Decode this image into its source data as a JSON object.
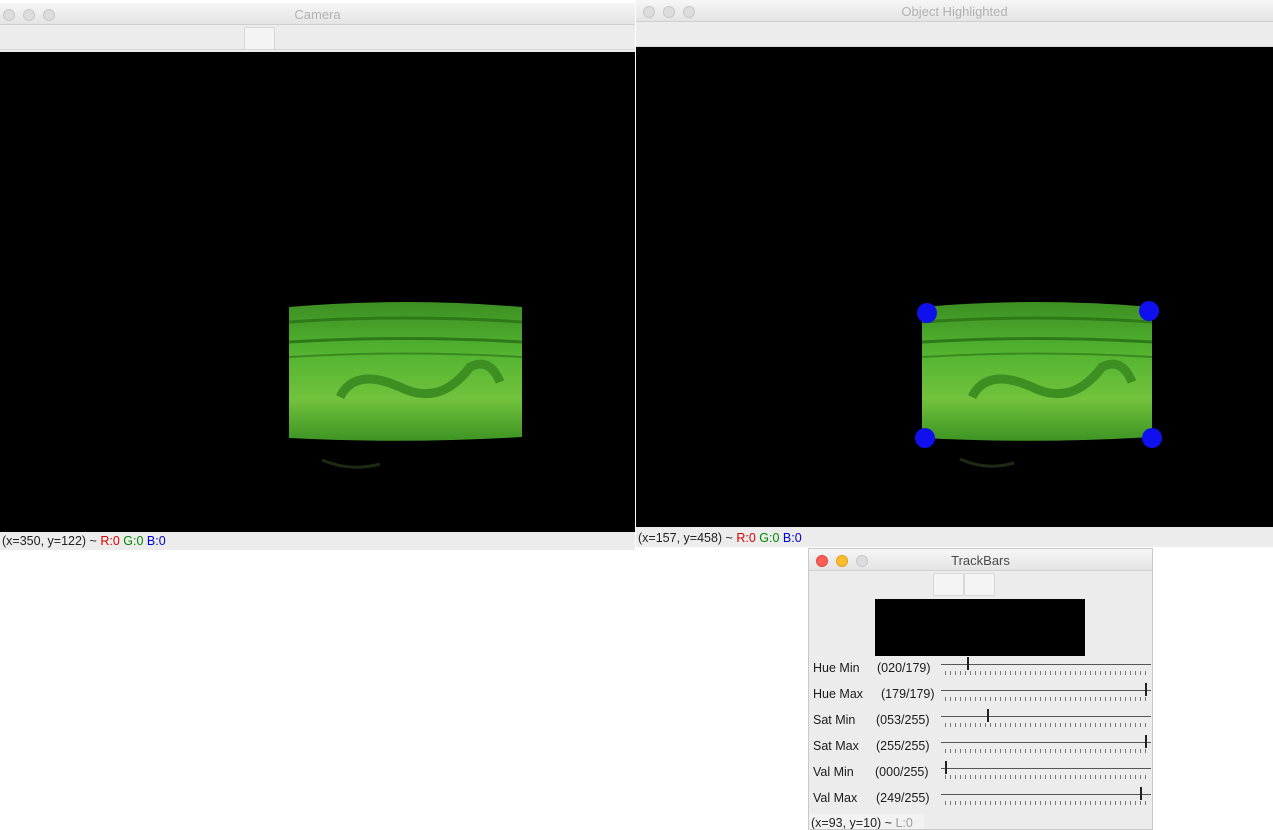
{
  "camera_window": {
    "title": "Camera",
    "status": {
      "coords": "(x=350, y=122) ~",
      "r": "R:0",
      "g": "G:0",
      "b": "B:0"
    }
  },
  "highlight_window": {
    "title": "Object Highlighted",
    "status": {
      "coords": "(x=157, y=458) ~",
      "r": "R:0",
      "g": "G:0",
      "b": "B:0"
    }
  },
  "trackbars_window": {
    "title": "TrackBars",
    "status": {
      "coords": "(x=93, y=10) ~",
      "l": "L:0"
    },
    "trackbars": [
      {
        "name": "Hue Min",
        "value_text": "(020/179)",
        "value": 20,
        "max": 179
      },
      {
        "name": "Hue Max",
        "value_text": "(179/179)",
        "value": 179,
        "max": 179
      },
      {
        "name": "Sat Min",
        "value_text": "(053/255)",
        "value": 53,
        "max": 255
      },
      {
        "name": "Sat Max",
        "value_text": "(255/255)",
        "value": 255,
        "max": 255
      },
      {
        "name": "Val Min",
        "value_text": "(000/255)",
        "value": 0,
        "max": 255
      },
      {
        "name": "Val Max",
        "value_text": "(249/255)",
        "value": 249,
        "max": 255
      }
    ]
  },
  "colors": {
    "marker": "#1010ee",
    "object_green": "#4caf2a"
  },
  "icons": {
    "close": "close-icon",
    "minimize": "minimize-icon",
    "zoom": "zoom-icon"
  }
}
